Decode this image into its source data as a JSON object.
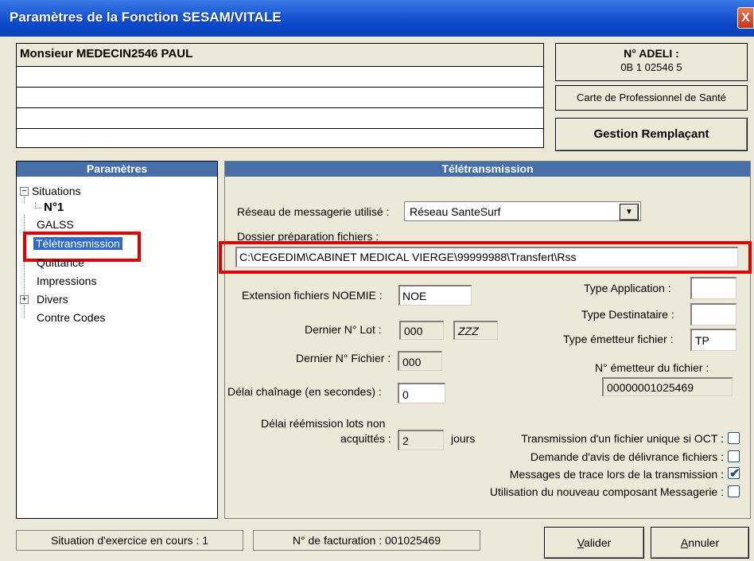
{
  "window": {
    "title": "Paramètres de la Fonction SESAM/VITALE",
    "close_glyph": "X"
  },
  "doctor": {
    "name": "Monsieur MEDECIN2546 PAUL",
    "lines": [
      "",
      "",
      "",
      ""
    ]
  },
  "adeli": {
    "label": "N° ADELI :",
    "value": "0B 1 02546 5"
  },
  "cps_label": "Carte de Professionnel de Santé",
  "gestion_button": "Gestion Remplaçant",
  "left_panel": {
    "header": "Paramètres",
    "tree": [
      {
        "label": "Situations",
        "expander": "−"
      },
      {
        "label": "N°1"
      },
      {
        "label": "GALSS"
      },
      {
        "label": "Télétransmission"
      },
      {
        "label": "Quittance"
      },
      {
        "label": "Impressions"
      },
      {
        "label": "Divers",
        "expander": "+"
      },
      {
        "label": "Contre Codes"
      }
    ]
  },
  "right_panel": {
    "header": "Télétransmission",
    "reseau_label": "Réseau de messagerie utilisé :",
    "reseau_value": "Réseau SanteSurf",
    "dossier_label": "Dossier préparation fichiers :",
    "dossier_value": "C:\\CEGEDIM\\CABINET MEDICAL VIERGE\\99999988\\Transfert\\Rss",
    "ext_label": "Extension fichiers NOEMIE :",
    "ext_value": "NOE",
    "lot_label": "Dernier N° Lot :",
    "lot_value": "000",
    "lot_value2": "ZZZ",
    "fichier_label": "Dernier N° Fichier :",
    "fichier_value": "000",
    "chainage_label": "Délai chaînage (en secondes) :",
    "chainage_value": "0",
    "reemission_label1": "Délai réémission lots non",
    "reemission_label2": "acquittés :",
    "reemission_value": "2",
    "jours": "jours",
    "type_app_label": "Type Application :",
    "type_app_value": "",
    "type_dest_label": "Type Destinataire :",
    "type_dest_value": "",
    "type_emet_label": "Type émetteur fichier :",
    "type_emet_value": "TP",
    "num_emet_label": "N° émetteur du fichier :",
    "num_emet_value": "00000001025469",
    "checkboxes": [
      {
        "label": "Transmission d'un fichier unique si OCT :",
        "checked": false
      },
      {
        "label": "Demande d'avis de délivrance fichiers :",
        "checked": false
      },
      {
        "label": "Messages de trace lors de la transmission :",
        "checked": true
      },
      {
        "label": "Utilisation du nouveau composant Messagerie :",
        "checked": false
      }
    ]
  },
  "status": {
    "situation": "Situation d'exercice en cours : 1",
    "facturation": "N° de facturation : 001025469"
  },
  "buttons": {
    "valider_accel": "V",
    "valider_rest": "alider",
    "annuler_accel": "A",
    "annuler_rest": "nnuler"
  },
  "colors": {
    "highlight": "#e00000",
    "header": "#456fa6",
    "title": "#0a46c7"
  }
}
